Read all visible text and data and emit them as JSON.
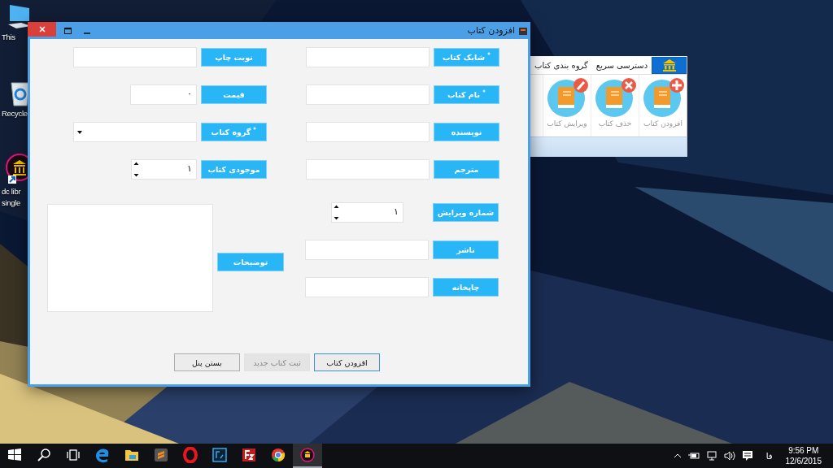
{
  "desktop": {
    "icons": [
      {
        "kind": "computer",
        "lines": [
          "This"
        ]
      },
      {
        "kind": "recycle",
        "lines": [
          "Recycle"
        ]
      },
      {
        "kind": "library",
        "lines": [
          "dc libr",
          "single"
        ]
      }
    ]
  },
  "background_window": {
    "tabs": [
      {
        "kind": "icon",
        "selected": true
      },
      {
        "kind": "text",
        "label": "دسترسی سریع",
        "selected": false
      },
      {
        "kind": "text",
        "label": "گروه بندی کتاب",
        "selected": false
      }
    ],
    "buttons": [
      {
        "kind": "add",
        "label": "افزودن کتاب",
        "disabled": true
      },
      {
        "kind": "delete",
        "label": "حذف کتاب",
        "disabled": true
      },
      {
        "kind": "edit",
        "label": "ویرایش کتاب",
        "disabled": true
      }
    ]
  },
  "dialog": {
    "title": "افزودن کتاب",
    "left_fields": [
      {
        "kind": "text",
        "label": "نوبت چاپ",
        "required": false
      },
      {
        "kind": "short",
        "label": "قیمت",
        "value": "۰",
        "required": false
      },
      {
        "kind": "combo",
        "label": "گروه کتاب",
        "required": true
      },
      {
        "kind": "spin",
        "label": "موجودی کتاب",
        "value": "۱",
        "required": false
      }
    ],
    "right_fields": [
      {
        "kind": "text",
        "label": "شابک کتاب",
        "required": true
      },
      {
        "kind": "text",
        "label": "نام کتاب",
        "required": true
      },
      {
        "kind": "text",
        "label": "نویسنده",
        "required": false
      },
      {
        "kind": "text",
        "label": "مترجم",
        "required": false
      }
    ],
    "bottom_fields": [
      {
        "kind": "spin",
        "label": "شماره ویرایش",
        "value": "۱",
        "required": false
      },
      {
        "kind": "text",
        "label": "ناشر",
        "required": false
      },
      {
        "kind": "text",
        "label": "چاپخانه",
        "required": false
      }
    ],
    "description": {
      "label": "توضیحات"
    },
    "buttons": [
      {
        "label": "افزودن کتاب",
        "disabled": false,
        "focused": true
      },
      {
        "label": "ثبت کتاب جدید",
        "disabled": true,
        "focused": false
      },
      {
        "label": "بستن پنل",
        "disabled": false,
        "focused": false
      }
    ]
  },
  "taskbar": {
    "apps": [
      {
        "kind": "start",
        "active": false
      },
      {
        "kind": "search",
        "active": false
      },
      {
        "kind": "taskview",
        "active": false
      },
      {
        "kind": "edge",
        "active": false
      },
      {
        "kind": "explorer",
        "active": false
      },
      {
        "kind": "sublime",
        "active": false
      },
      {
        "kind": "opera",
        "active": false
      },
      {
        "kind": "photoshop",
        "active": false
      },
      {
        "kind": "filezilla",
        "active": false
      },
      {
        "kind": "chrome",
        "active": false
      },
      {
        "kind": "library",
        "active": true
      }
    ],
    "tray": {
      "language": "فا",
      "time": "9:56 PM",
      "date": "12/6/2015"
    }
  }
}
